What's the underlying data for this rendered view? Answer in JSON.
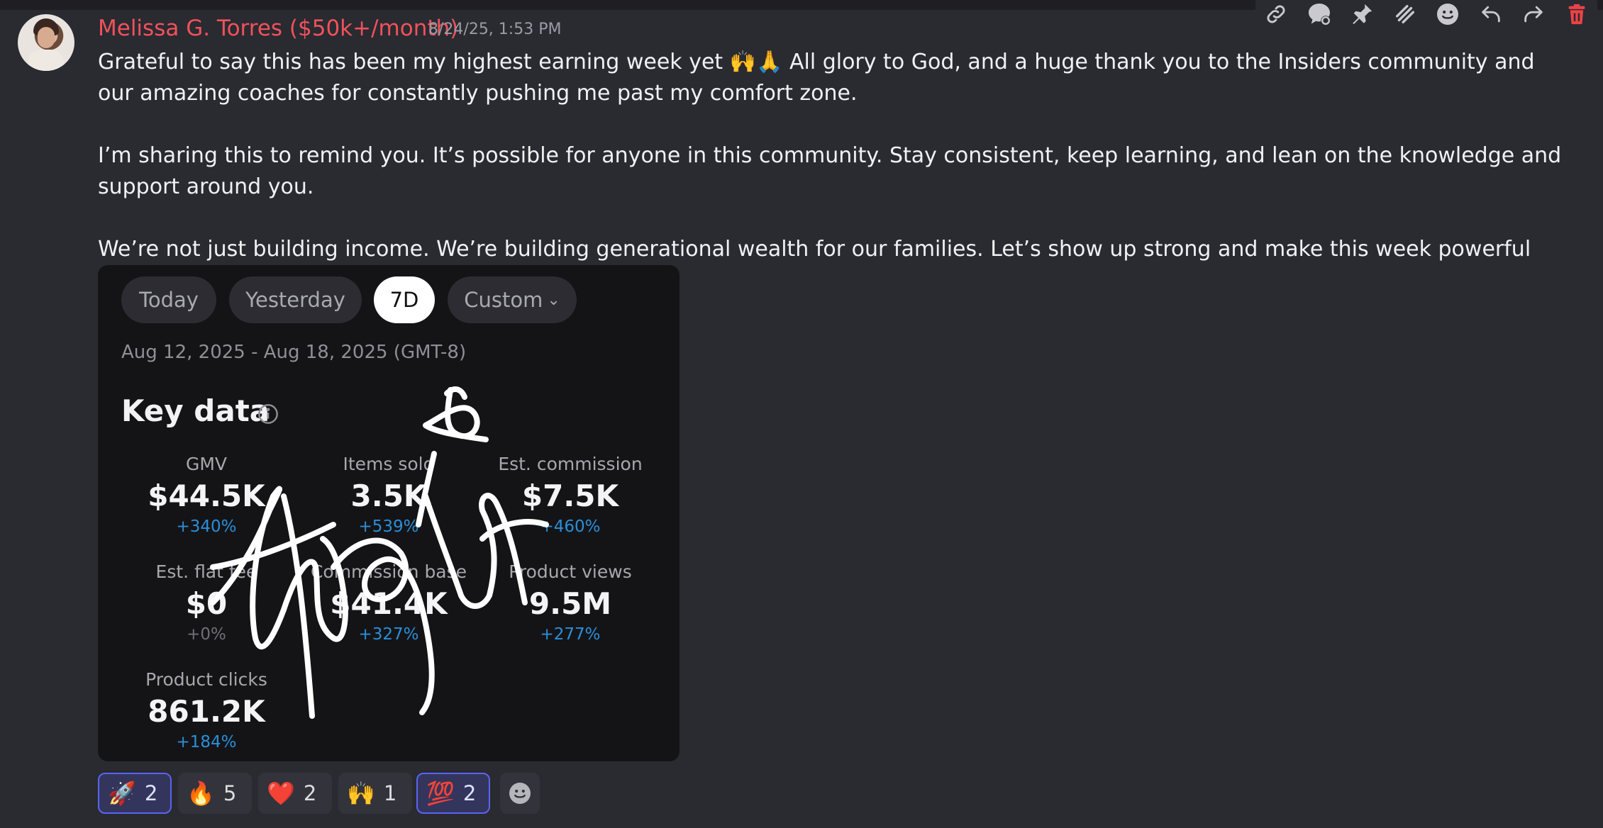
{
  "message": {
    "author": "Melissa G. Torres ($50k+/month)",
    "timestamp": "8/24/25, 1:53 PM",
    "author_color": "#f0525b",
    "paragraphs": [
      {
        "text": "Grateful to say this has been my highest earning week yet",
        "emoji": "🙌🙏",
        "text2": " All glory to God, and a huge thank you to the Insiders community and our amazing coaches for constantly pushing me past my comfort zone."
      },
      {
        "text": "I’m sharing this to remind you. It’s possible for anyone in this community. Stay consistent, keep learning, and lean on the knowledge and support around you."
      },
      {
        "text": "We’re not just building income. We’re building generational wealth for our families. Let’s show up strong and make this week powerful together",
        "emoji": "💪🔥"
      }
    ]
  },
  "toolbar": {
    "icons": [
      "link-icon",
      "thread-icon",
      "pin-icon",
      "stripes-icon",
      "emoji-icon",
      "reply-icon",
      "forward-icon",
      "trash-icon"
    ]
  },
  "dashboard": {
    "tabs": [
      {
        "label": "Today",
        "active": false
      },
      {
        "label": "Yesterday",
        "active": false
      },
      {
        "label": "7D",
        "active": true
      },
      {
        "label": "Custom",
        "active": false,
        "chevron": "⌄"
      }
    ],
    "date_range": "Aug 12, 2025 - Aug 18, 2025 (GMT-8)",
    "title": "Key data",
    "metrics": [
      {
        "label": "GMV",
        "value": "$44.5K",
        "change": "+340%"
      },
      {
        "label": "Items sold",
        "value": "3.5K",
        "change": "+539%"
      },
      {
        "label": "Est. commission",
        "value": "$7.5K",
        "change": "+460%"
      },
      {
        "label": "Est. flat fee",
        "value": "$0",
        "change": "+0%"
      },
      {
        "label": "Commission base",
        "value": "$41.4K",
        "change": "+327%"
      },
      {
        "label": "Product views",
        "value": "9.5M",
        "change": "+277%"
      },
      {
        "label": "Product clicks",
        "value": "861.2K",
        "change": "+184%"
      }
    ],
    "accent": "#2b8fd9"
  },
  "reactions": [
    {
      "emoji": "🚀",
      "count": "2",
      "me": true
    },
    {
      "emoji": "🔥",
      "count": "5",
      "me": false
    },
    {
      "emoji": "❤️",
      "count": "2",
      "me": false
    },
    {
      "emoji": "🙌",
      "count": "1",
      "me": false
    },
    {
      "emoji": "💯",
      "count": "2",
      "me": true
    }
  ],
  "add_reaction_icon": "add-reaction-icon"
}
